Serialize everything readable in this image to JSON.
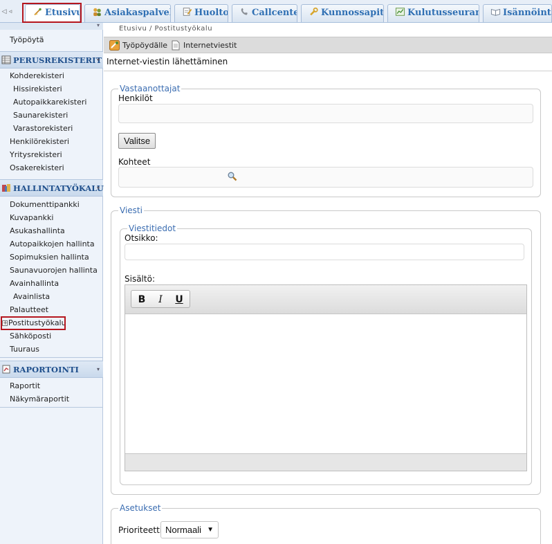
{
  "tabs": [
    {
      "label": "Etusivu",
      "icon": "home-icon",
      "active": true
    },
    {
      "label": "Asiakaspalvelu",
      "icon": "people-icon"
    },
    {
      "label": "Huolto",
      "icon": "notepad-icon"
    },
    {
      "label": "Callcenter",
      "icon": "phone-icon"
    },
    {
      "label": "Kunnossapito",
      "icon": "wrench-icon"
    },
    {
      "label": "Kulutusseuranta",
      "icon": "chart-icon"
    },
    {
      "label": "Isännöinti",
      "icon": "book-icon"
    }
  ],
  "sidebar": {
    "top_item": "Työpöytä",
    "sections": [
      {
        "title": "PERUSREKISTERIT",
        "icon": "table-icon",
        "items": [
          "Kohderekisteri",
          "Hissirekisteri",
          "Autopaikkarekisteri",
          "Saunarekisteri",
          "Varastorekisteri",
          "Henkilörekisteri",
          "Yritysrekisteri",
          "Osakerekisteri"
        ]
      },
      {
        "title": "HALLINTATYÖKALUT",
        "icon": "tools-icon",
        "items": [
          "Dokumenttipankki",
          "Kuvapankki",
          "Asukashallinta",
          "Autopaikkojen hallinta",
          "Sopimuksien hallinta",
          "Saunavuorojen hallinta",
          "Avainhallinta",
          "Avainlista",
          "Palautteet",
          "Postitustyökalu",
          "Sähköposti",
          "Tuuraus"
        ]
      },
      {
        "title": "RAPORTOINTI",
        "icon": "report-icon",
        "items": [
          "Raportit",
          "Näkymäraportit"
        ]
      }
    ]
  },
  "breadcrumb": "Etusivu / Postitustyökalu",
  "toolbar": {
    "desktop": "Työpöydälle",
    "messages": "Internetviestit"
  },
  "page_title": "Internet-viestin lähettäminen",
  "recipients": {
    "legend": "Vastaanottajat",
    "persons_label": "Henkilöt",
    "choose_button": "Valitse",
    "targets_label": "Kohteet"
  },
  "message": {
    "legend": "Viesti",
    "info_legend": "Viestitiedot",
    "subject_label": "Otsikko:",
    "content_label": "Sisältö:",
    "bold": "B",
    "italic": "I",
    "underline": "U"
  },
  "settings": {
    "legend": "Asetukset",
    "priority_label": "Prioriteetti:",
    "priority_value": "Normaali"
  },
  "colors": {
    "accent": "#2f6fb3",
    "highlight": "#b5161e",
    "section_title": "#1f4f8c"
  }
}
